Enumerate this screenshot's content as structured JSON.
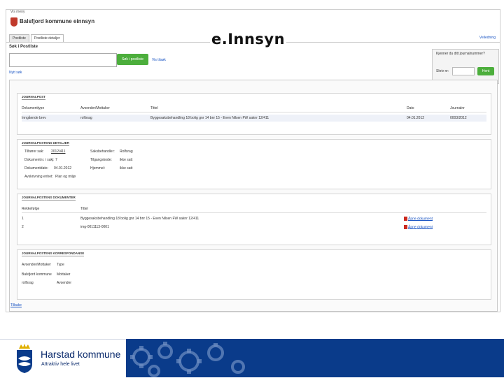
{
  "slide_title": "e.Innsyn",
  "browser": {
    "top_strip": "Vis meny",
    "municipality": "Balsfjord kommune einnsyn"
  },
  "tabs": [
    {
      "label": "Postliste"
    },
    {
      "label": "Postliste detaljer"
    }
  ],
  "help_link": "Veiledning",
  "search": {
    "heading": "Søk i Postliste",
    "button": "Søk i postliste",
    "more_link": "Vis tilsøk",
    "new_search_link": "Nytt søk"
  },
  "journal_panel": {
    "question": "Kjenner du ditt journalnummer?",
    "label": "Skriv nr:",
    "button": "Hent"
  },
  "journalpost": {
    "title": "JOURNALPOST",
    "headers": [
      "Dokumenttype",
      "Avsender/Mottaker",
      "Tittel",
      "Dato",
      "Journalnr"
    ],
    "rows": [
      [
        "Inngående brev",
        "rolfsrag",
        "Byggesaksbehandling 18 bolig gnr 14 bnr 15 - Even Nilsen FW saknr 12/411",
        "04.01.2012",
        "0003/2012"
      ]
    ]
  },
  "details": {
    "title": "JOURNALPOSTENS DETALJER",
    "saksnr_label": "Tilhører sak:",
    "saksnr_value": "2012/411",
    "doknr_label": "Dokumentnr. i sakj:",
    "doknr_value": "7",
    "dokdato_label": "Dokumentdato:",
    "dokdato_value": "04.01.2012",
    "avskriving_label": "Avskrivning enhet:",
    "avskriving_value": "Plan og miljø",
    "saksbeh_label": "Saksbehandler:",
    "saksbeh_value": "Rolfsrag",
    "tilgang_label": "Tilgangskode:",
    "tilgang_value": "ikke satt",
    "hjemmel_label": "Hjemmel:",
    "hjemmel_value": "ikke satt"
  },
  "documents": {
    "title": "JOURNALPOSTENS DOKUMENTER",
    "headers": [
      "Rekkefølge",
      "Tittel"
    ],
    "rows": [
      {
        "order": "1",
        "title": "Byggesaksbehandling 18 bolig gnr 14 bnr 15 - Even Nilsen FW saknr 12/411",
        "link": "Åpne dokument"
      },
      {
        "order": "2",
        "title": "img-0011113-0001",
        "link": "Åpne dokument"
      }
    ]
  },
  "correspondence": {
    "title": "JOURNALPOSTENS KORRESPONDANSE",
    "headers": [
      "Avsender/Mottaker",
      "Type"
    ],
    "rows": [
      [
        "Balsfjord kommune",
        "Mottaker"
      ],
      [
        "rolfsrag",
        "Avsender"
      ]
    ]
  },
  "close_link": "Tilbake",
  "footer": {
    "org_name": "Harstad kommune",
    "slogan": "Attraktiv hele livet",
    "brand_color": "#0a3b8a"
  },
  "colors": {
    "button_green": "#4cae3c",
    "link_blue": "#1a55c4",
    "crest_red": "#c0392b"
  }
}
